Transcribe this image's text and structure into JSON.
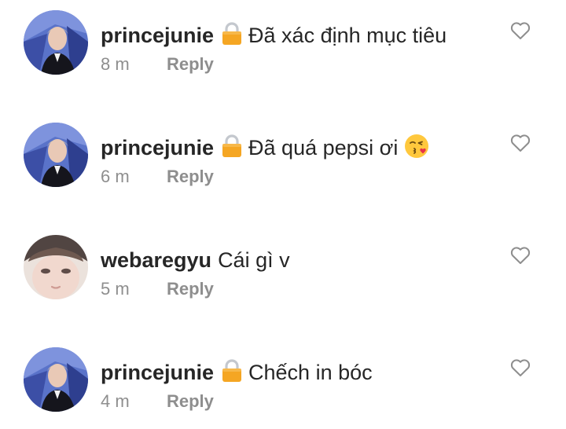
{
  "comments": [
    {
      "username": "princejunie",
      "badge_icon": "lock-icon",
      "text": "Đã xác định mục tiêu",
      "time": "8 m",
      "reply_label": "Reply",
      "avatar": "profile-photo-man-stage"
    },
    {
      "username": "princejunie",
      "badge_icon": "lock-icon",
      "text": "Đã quá pepsi ơi",
      "emoji": "face-blowing-kiss-emoji",
      "time": "6 m",
      "reply_label": "Reply",
      "avatar": "profile-photo-man-stage"
    },
    {
      "username": "webaregyu",
      "text": "Cái gì v",
      "time": "5 m",
      "reply_label": "Reply",
      "avatar": "profile-photo-closeup-face"
    },
    {
      "username": "princejunie",
      "badge_icon": "lock-icon",
      "text": "Chếch in bóc",
      "time": "4 m",
      "reply_label": "Reply",
      "avatar": "profile-photo-man-stage"
    }
  ],
  "colors": {
    "text": "#262626",
    "secondary": "#8e8e8e",
    "lock": "#f5a623"
  },
  "like_icon": "heart-outline-icon"
}
